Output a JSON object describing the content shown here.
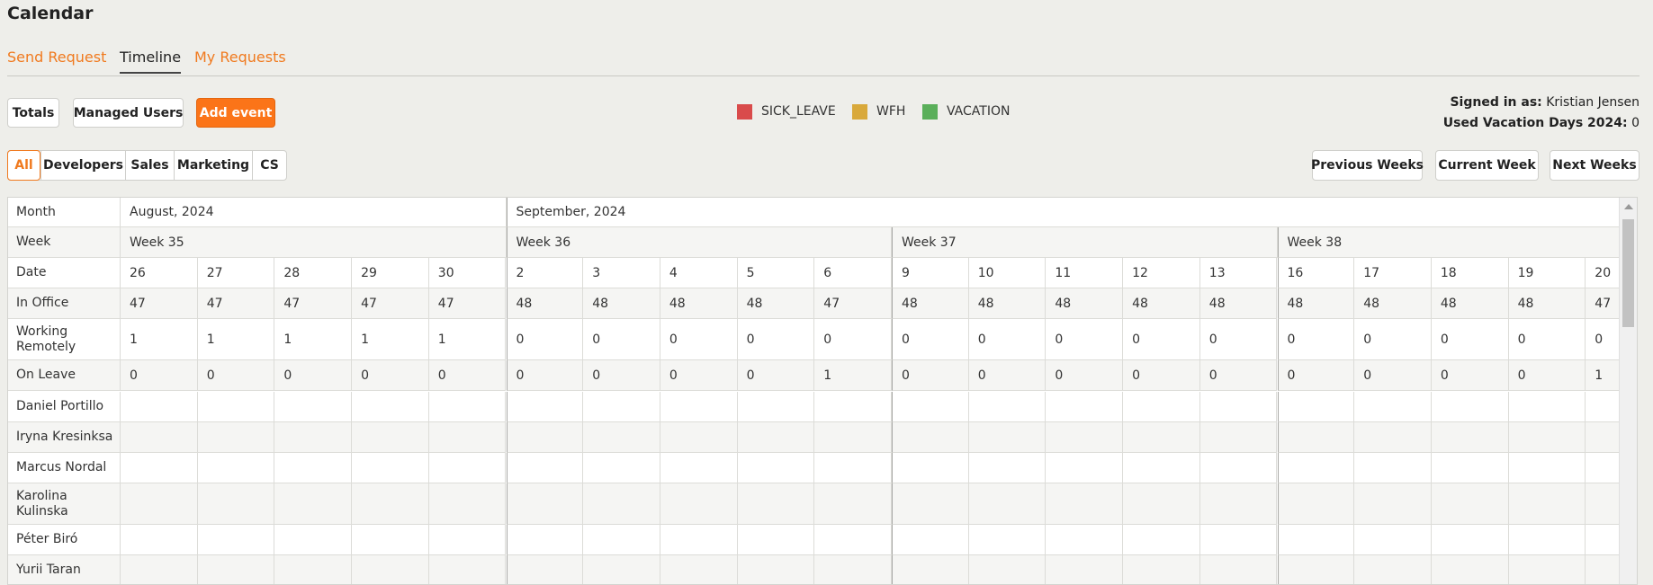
{
  "header": {
    "title": "Calendar"
  },
  "tabs": [
    {
      "label": "Send Request",
      "active": false
    },
    {
      "label": "Timeline",
      "active": true
    },
    {
      "label": "My Requests",
      "active": false
    }
  ],
  "toolbar": {
    "totals_label": "Totals",
    "managed_users_label": "Managed Users",
    "add_event_label": "Add event"
  },
  "legend": [
    {
      "label": "SICK_LEAVE",
      "color": "#d94b4b"
    },
    {
      "label": "WFH",
      "color": "#d9a93b"
    },
    {
      "label": "VACATION",
      "color": "#5aaf5a"
    }
  ],
  "user": {
    "signed_in_label": "Signed in as:",
    "signed_in_value": "Kristian Jensen",
    "used_vacation_label": "Used Vacation Days 2024:",
    "used_vacation_value": "0"
  },
  "filters": [
    {
      "label": "All",
      "active": true
    },
    {
      "label": "Developers",
      "active": false
    },
    {
      "label": "Sales",
      "active": false
    },
    {
      "label": "Marketing",
      "active": false
    },
    {
      "label": "CS",
      "active": false
    }
  ],
  "nav": {
    "previous_label": "Previous Weeks",
    "current_label": "Current Week",
    "next_label": "Next Weeks"
  },
  "timeline": {
    "row_labels": {
      "month": "Month",
      "week": "Week",
      "date": "Date",
      "in_office": "In Office",
      "working_remotely": "Working Remotely",
      "on_leave": "On Leave"
    },
    "months": [
      {
        "label": "August, 2024",
        "span": 5
      },
      {
        "label": "September, 2024",
        "span": 15
      }
    ],
    "weeks": [
      {
        "label": "Week 35",
        "span": 5
      },
      {
        "label": "Week 36",
        "span": 5
      },
      {
        "label": "Week 37",
        "span": 5
      },
      {
        "label": "Week 38",
        "span": 5
      }
    ],
    "dates": [
      "26",
      "27",
      "28",
      "29",
      "30",
      "2",
      "3",
      "4",
      "5",
      "6",
      "9",
      "10",
      "11",
      "12",
      "13",
      "16",
      "17",
      "18",
      "19",
      "20"
    ],
    "in_office": [
      "47",
      "47",
      "47",
      "47",
      "47",
      "48",
      "48",
      "48",
      "48",
      "47",
      "48",
      "48",
      "48",
      "48",
      "48",
      "48",
      "48",
      "48",
      "48",
      "47"
    ],
    "working_remotely": [
      "1",
      "1",
      "1",
      "1",
      "1",
      "0",
      "0",
      "0",
      "0",
      "0",
      "0",
      "0",
      "0",
      "0",
      "0",
      "0",
      "0",
      "0",
      "0",
      "0"
    ],
    "on_leave": [
      "0",
      "0",
      "0",
      "0",
      "0",
      "0",
      "0",
      "0",
      "0",
      "1",
      "0",
      "0",
      "0",
      "0",
      "0",
      "0",
      "0",
      "0",
      "0",
      "1"
    ],
    "people": [
      "Daniel Portillo",
      "Iryna Kresinksa",
      "Marcus Nordal",
      "Karolina Kulinska",
      "Péter Biró",
      "Yurii Taran"
    ]
  }
}
